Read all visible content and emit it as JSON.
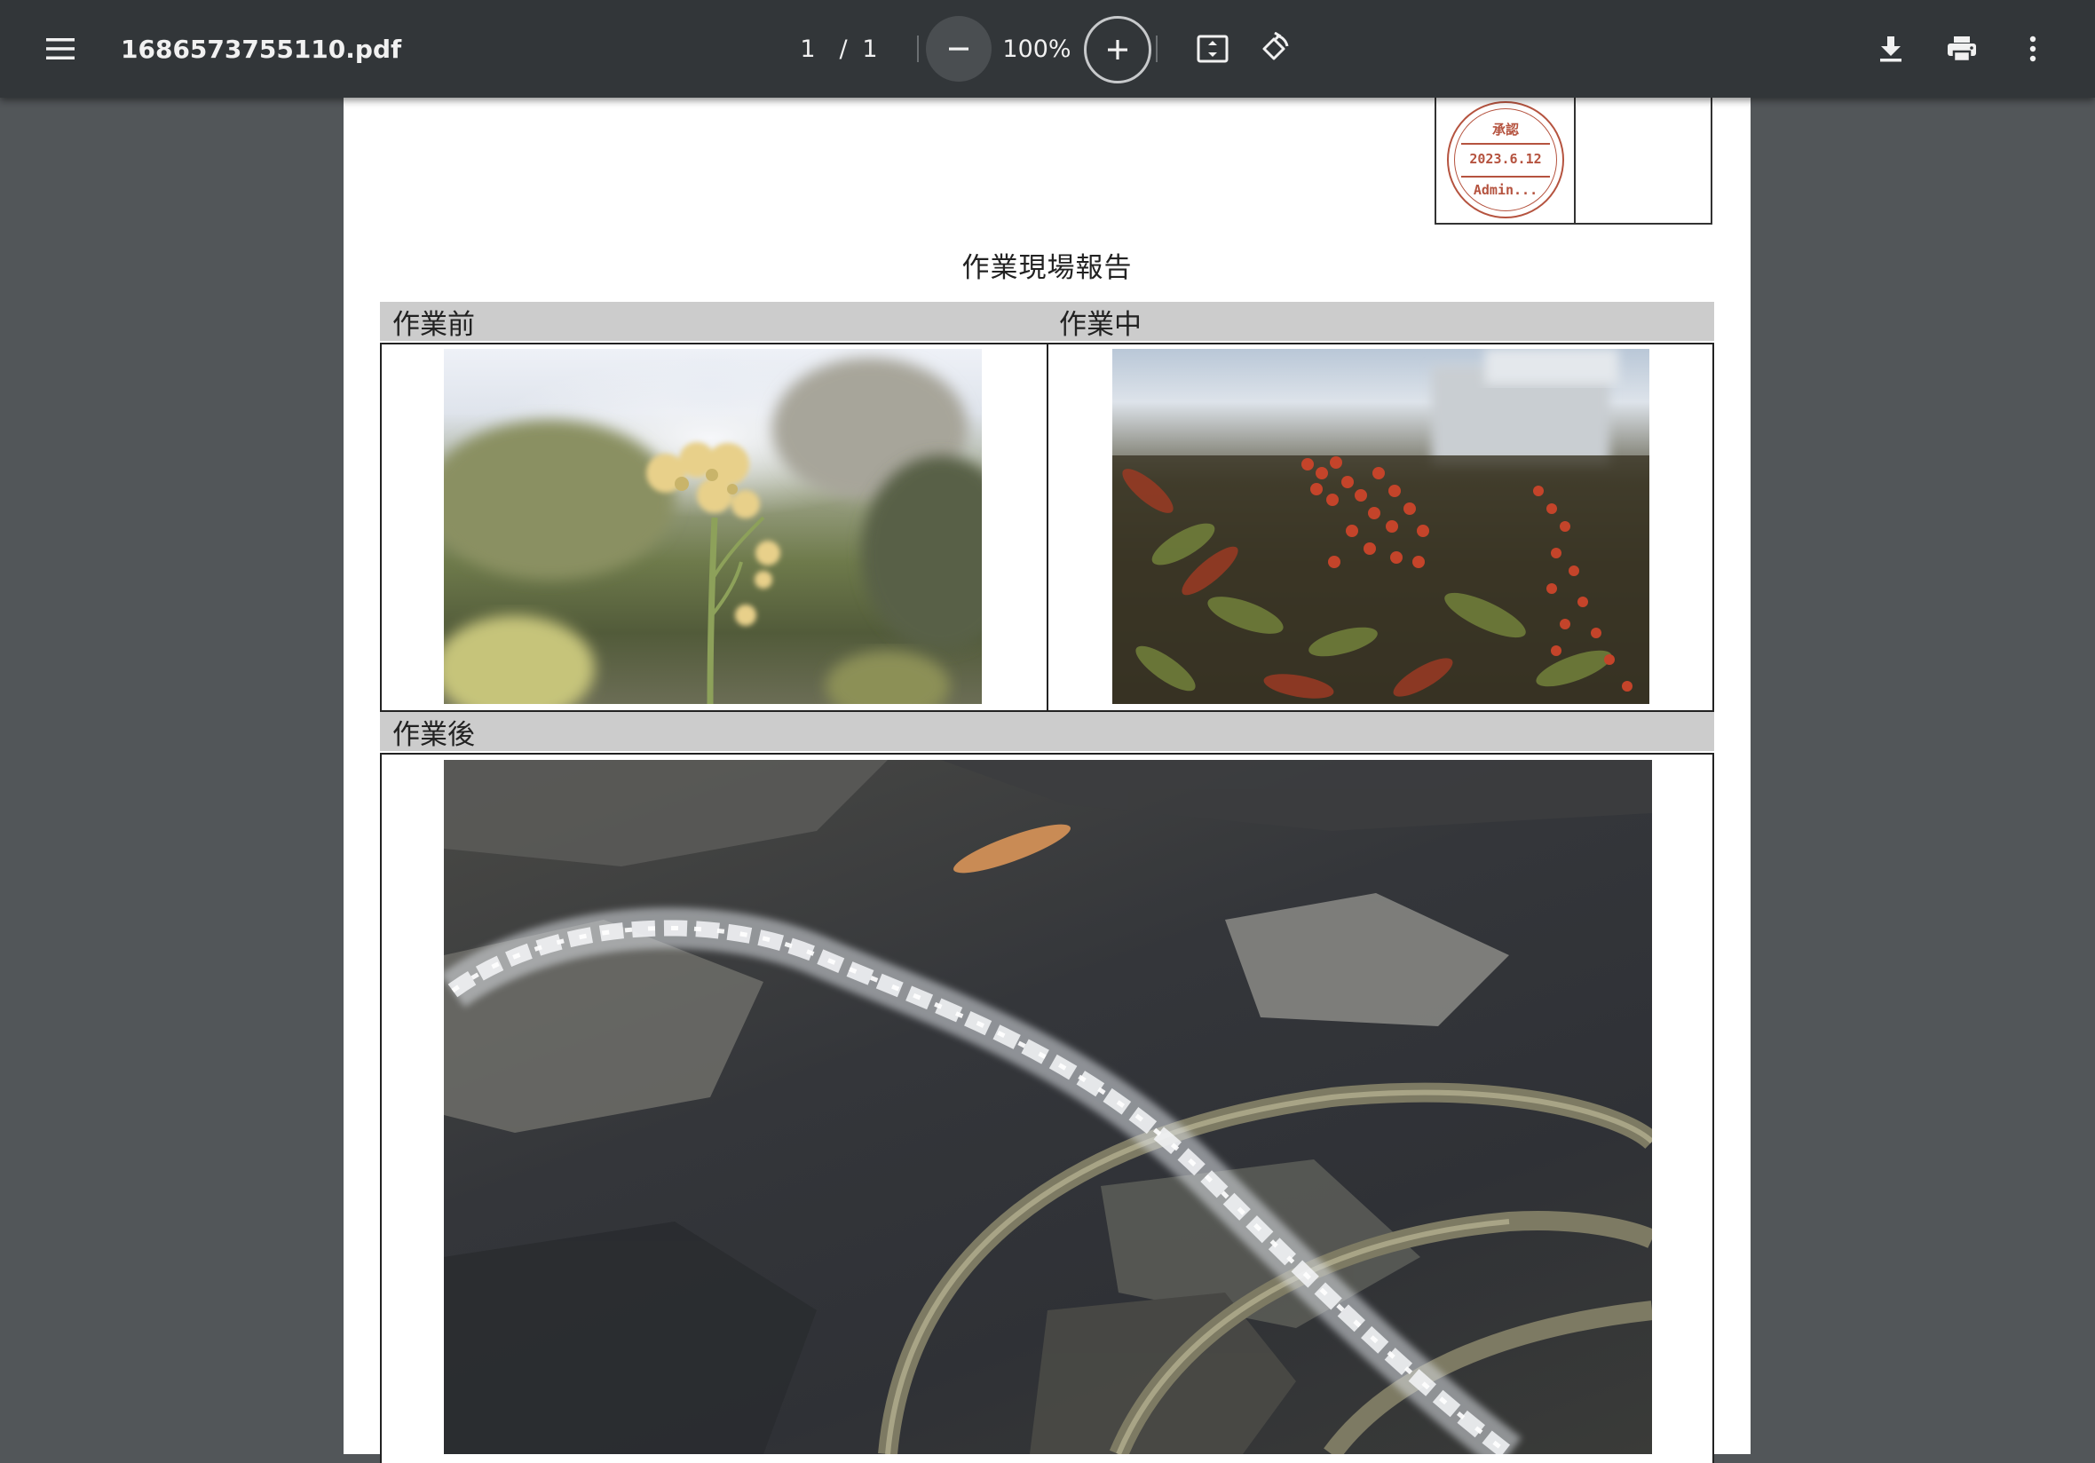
{
  "toolbar": {
    "filename": "1686573755110.pdf",
    "page_current": "1",
    "page_separator": "/",
    "page_total": "1",
    "zoom": "100%",
    "icons": {
      "menu": "hamburger-menu-icon",
      "zoom_out": "minus-icon",
      "zoom_in": "plus-icon",
      "fit": "fit-to-page-icon",
      "rotate": "rotate-counterclockwise-icon",
      "download": "download-icon",
      "print": "print-icon",
      "more": "more-vertical-icon"
    }
  },
  "document": {
    "stamp": {
      "top": "承認",
      "date": "2023.6.12",
      "name": "Admin..."
    },
    "title": "作業現場報告",
    "sections": {
      "before": "作業前",
      "during": "作業中",
      "after": "作業後"
    }
  },
  "colors": {
    "toolbar_bg": "#323639",
    "viewer_bg": "#525659",
    "header_bar": "#cccccc",
    "stamp": "#b5533f"
  }
}
